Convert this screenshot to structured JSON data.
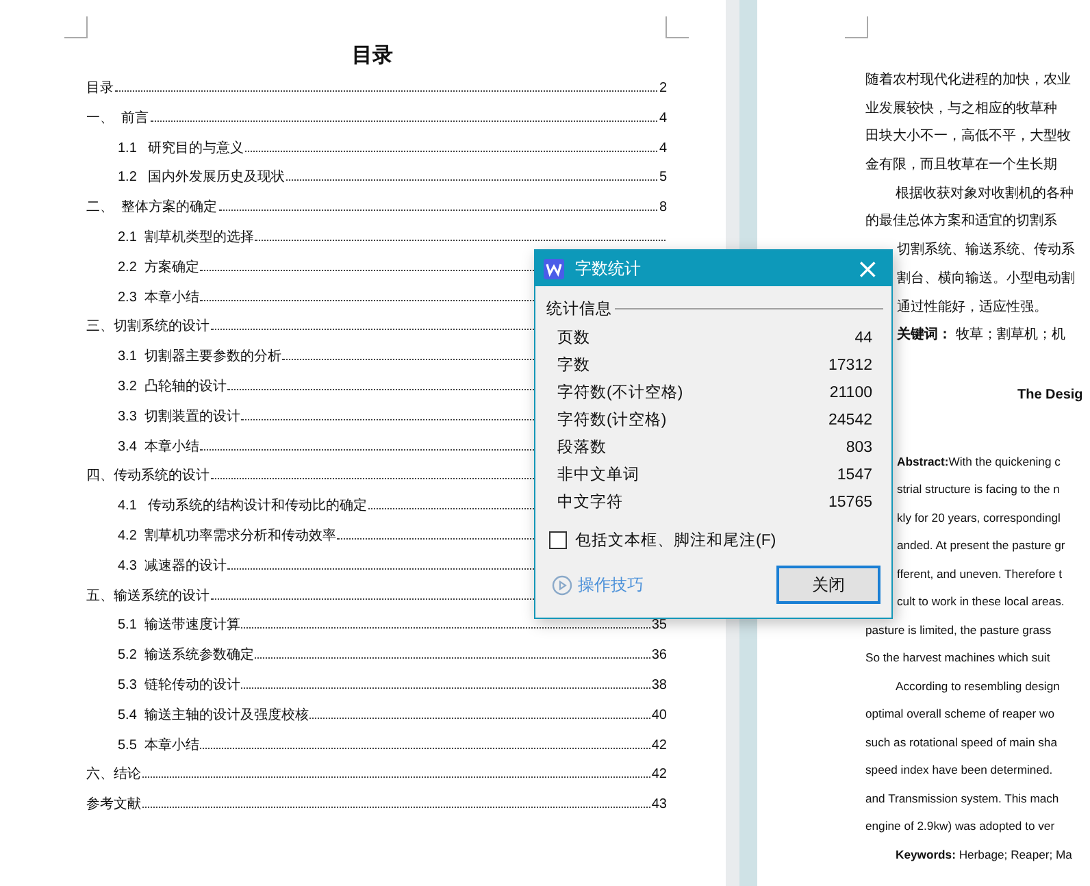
{
  "left_page": {
    "title": "目录",
    "toc": [
      {
        "title": "目录",
        "page": "2"
      },
      {
        "title": "一、  前言",
        "page": "4",
        "children": [
          {
            "title": "1.1   研究目的与意义",
            "page": "4"
          },
          {
            "title": "1.2   国内外发展历史及现状",
            "page": "5"
          }
        ]
      },
      {
        "title": "二、  整体方案的确定",
        "page": "8",
        "children": [
          {
            "title": "2.1  割草机类型的选择"
          },
          {
            "title": "2.2  方案确定"
          },
          {
            "title": "2.3  本章小结"
          }
        ]
      },
      {
        "title": "三、切割系统的设计",
        "children": [
          {
            "title": "3.1  切割器主要参数的分析"
          },
          {
            "title": "3.2  凸轮轴的设计"
          },
          {
            "title": "3.3  切割装置的设计"
          },
          {
            "title": "3.4  本章小结"
          }
        ]
      },
      {
        "title": "四、传动系统的设计",
        "children": [
          {
            "title": "4.1   传动系统的结构设计和传动比的确定"
          },
          {
            "title": "4.2  割草机功率需求分析和传动效率"
          },
          {
            "title": "4.3  减速器的设计"
          }
        ]
      },
      {
        "title": "五、输送系统的设计",
        "children": [
          {
            "title": "5.1  输送带速度计算",
            "page": "35"
          },
          {
            "title": "5.2  输送系统参数确定",
            "page": "36"
          },
          {
            "title": "5.3  链轮传动的设计",
            "page": "38"
          },
          {
            "title": "5.4  输送主轴的设计及强度校核",
            "page": "40"
          },
          {
            "title": "5.5  本章小结",
            "page": "42"
          }
        ]
      },
      {
        "title": "六、结论",
        "page": "42"
      },
      {
        "title": "参考文献",
        "page": "43"
      }
    ]
  },
  "right_page": {
    "lines": [
      {
        "kind": "full",
        "text": "随着农村现代化进程的加快，农业"
      },
      {
        "kind": "full",
        "text": "业发展较快，与之相应的牧草种"
      },
      {
        "kind": "full",
        "text": "田块大小不一，高低不平，大型牧"
      },
      {
        "kind": "full",
        "text": "金有限，而且牧草在一个生长期"
      },
      {
        "kind": "indent",
        "text": "根据收获对象对收割机的各种"
      },
      {
        "kind": "full",
        "text": "的最佳总体方案和适宜的切割系"
      },
      {
        "kind": "cut",
        "text": "切割系统、输送系统、传动系"
      },
      {
        "kind": "cut",
        "text": "割台、横向输送。小型电动割"
      },
      {
        "kind": "cut",
        "text": "通过性能好，适应性强。"
      },
      {
        "kind": "cut",
        "text": "**关键词：** 牧草；割草机；机"
      }
    ],
    "heading": "The Desig",
    "abstract_lines": [
      {
        "kind": "cut",
        "text": "**Abstract:**With the quickening c"
      },
      {
        "kind": "cut",
        "text": "strial structure is facing to the n"
      },
      {
        "kind": "cut",
        "text": "kly for 20 years, correspondingl"
      },
      {
        "kind": "cut",
        "text": "anded. At present the pasture gr"
      },
      {
        "kind": "cut",
        "text": "fferent, and uneven. Therefore t"
      },
      {
        "kind": "cut",
        "text": "cult to work in these local areas."
      },
      {
        "kind": "full",
        "text": "pasture is limited, the pasture grass"
      },
      {
        "kind": "full",
        "text": "So the harvest machines which suit"
      },
      {
        "kind": "indent",
        "text": "According to resembling design"
      },
      {
        "kind": "full",
        "text": "optimal overall scheme of reaper wo"
      },
      {
        "kind": "full",
        "text": "such as rotational speed of main sha"
      },
      {
        "kind": "full",
        "text": "speed index have been determined."
      },
      {
        "kind": "full",
        "text": "and Transmission system. This mach"
      },
      {
        "kind": "full",
        "text": "engine of 2.9kw) was adopted to ver"
      },
      {
        "kind": "indent",
        "text": "**Keywords:** Herbage; Reaper; Ma"
      }
    ]
  },
  "dialog": {
    "title": "字数统计",
    "close": "×",
    "group": "统计信息",
    "stats": [
      {
        "label": "页数",
        "value": "44"
      },
      {
        "label": "字数",
        "value": "17312"
      },
      {
        "label": "字符数(不计空格)",
        "value": "21100"
      },
      {
        "label": "字符数(计空格)",
        "value": "24542"
      },
      {
        "label": "段落数",
        "value": "803"
      },
      {
        "label": "非中文单词",
        "value": "1547"
      },
      {
        "label": "中文字符",
        "value": "15765"
      }
    ],
    "checkbox": {
      "label": "包括文本框、脚注和尾注(F)",
      "checked": false
    },
    "tips": "操作技巧",
    "button": "关闭"
  }
}
